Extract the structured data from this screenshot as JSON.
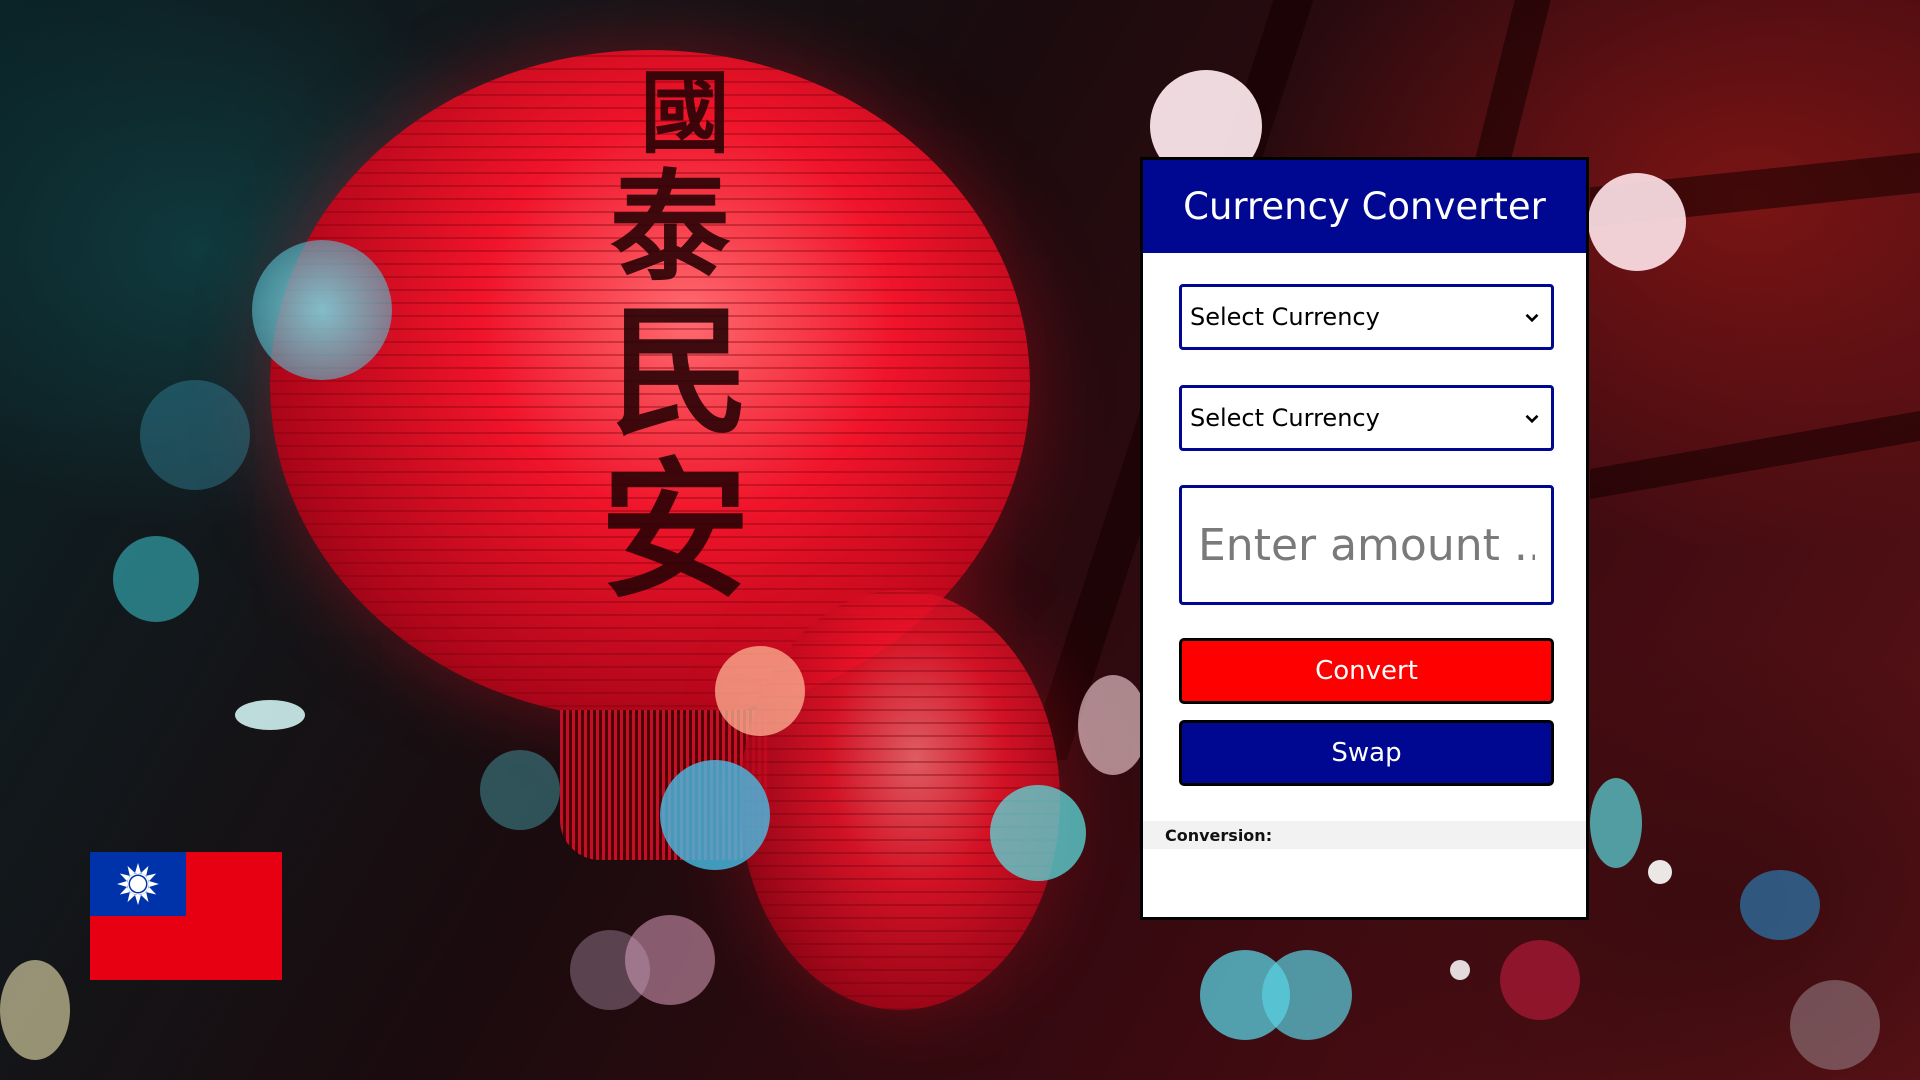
{
  "converter": {
    "title": "Currency Converter",
    "from_select": {
      "value": "Select Currency",
      "icon": "chevron-down-icon"
    },
    "to_select": {
      "value": "Select Currency",
      "icon": "chevron-down-icon"
    },
    "amount": {
      "placeholder": "Enter amount ...",
      "value": ""
    },
    "convert_label": "Convert",
    "swap_label": "Swap",
    "result_label": "Conversion:"
  },
  "flag": {
    "name": "flag-of-taiwan"
  },
  "background": {
    "lantern_text": "國泰民安"
  },
  "colors": {
    "header_blue": "#000891",
    "convert_red": "#ff0000",
    "swap_blue": "#000891",
    "flag_red": "#e60012",
    "flag_blue": "#0033aa"
  }
}
